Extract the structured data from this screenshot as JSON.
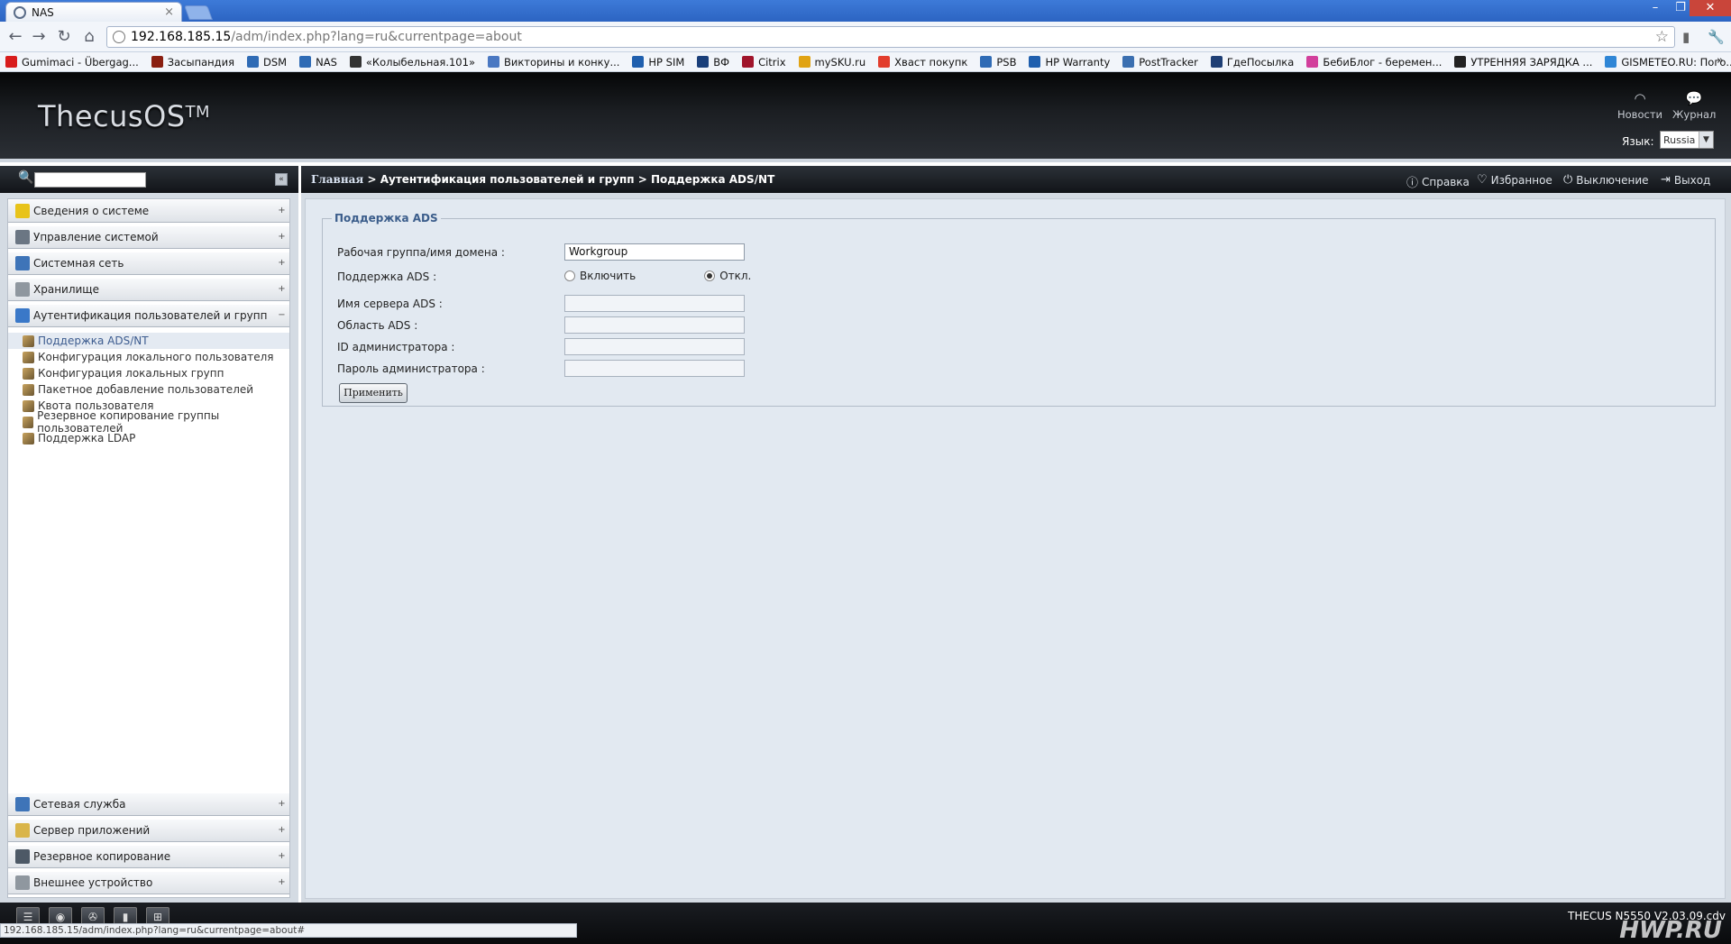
{
  "browser": {
    "tab_title": "NAS",
    "url_host": "192.168.185.15",
    "url_path": "/adm/index.php?lang=ru&currentpage=about",
    "bookmarks": [
      {
        "label": "Gumimaci - Übergag...",
        "color": "#d81c1c"
      },
      {
        "label": "Засыпандия",
        "color": "#8a1f11"
      },
      {
        "label": "DSM",
        "color": "#2f6bb5"
      },
      {
        "label": "NAS",
        "color": "#2f6bb5"
      },
      {
        "label": "«Колыбельная.101»",
        "color": "#333333"
      },
      {
        "label": "Викторины и конку...",
        "color": "#4a78c2"
      },
      {
        "label": "HP SIM",
        "color": "#1f5fae"
      },
      {
        "label": "ВФ",
        "color": "#1a3f7a"
      },
      {
        "label": "Citrix",
        "color": "#a0142b"
      },
      {
        "label": "mySKU.ru",
        "color": "#e0a314"
      },
      {
        "label": "Хвaст покупк",
        "color": "#e23d2d"
      },
      {
        "label": "PSB",
        "color": "#2f6bb5"
      },
      {
        "label": "HP Warranty",
        "color": "#1f5fae"
      },
      {
        "label": "PostTracker",
        "color": "#3b6fb0"
      },
      {
        "label": "ГдеПосылка",
        "color": "#1f3f75"
      },
      {
        "label": "БебиБлог - беремен...",
        "color": "#d23f9c"
      },
      {
        "label": "УТРЕННЯЯ ЗАРЯДКА ...",
        "color": "#222222"
      },
      {
        "label": "GISMETEO.RU: Пого...",
        "color": "#2f86d6"
      }
    ],
    "bookmarks_more": "»"
  },
  "header": {
    "logo_text": "ThecusOS",
    "logo_tm": "TM",
    "news": "Новости",
    "journal": "Журнал",
    "lang_label": "Язык:",
    "lang_value": "Russia"
  },
  "sidebar": {
    "groups_top": [
      {
        "label": "Сведения о системе",
        "icon_color": "#e8c31a",
        "toggle": "+"
      },
      {
        "label": "Управление системой",
        "icon_color": "#6b7683",
        "toggle": "+"
      },
      {
        "label": "Системная сеть",
        "icon_color": "#3e74b8",
        "toggle": "+"
      },
      {
        "label": "Хранилище",
        "icon_color": "#8f979f",
        "toggle": "+"
      },
      {
        "label": "Аутентификация пользователей и групп",
        "icon_color": "#3a78c8",
        "toggle": "−"
      }
    ],
    "sub_items": [
      {
        "label": "Поддержка ADS/NT",
        "active": true
      },
      {
        "label": "Конфигурация локального пользователя",
        "active": false
      },
      {
        "label": "Конфигурация локальных групп",
        "active": false
      },
      {
        "label": "Пакетное добавление пользователей",
        "active": false
      },
      {
        "label": "Квота пользователя",
        "active": false
      },
      {
        "label": "Резервное копирование группы пользователей",
        "active": false
      },
      {
        "label": "Поддержка LDAP",
        "active": false
      }
    ],
    "groups_bottom": [
      {
        "label": "Сетевая служба",
        "icon_color": "#3e74b8",
        "toggle": "+"
      },
      {
        "label": "Сервер приложений",
        "icon_color": "#d9b54a",
        "toggle": "+"
      },
      {
        "label": "Резервное копирование",
        "icon_color": "#4d5966",
        "toggle": "+"
      },
      {
        "label": "Внешнее устройство",
        "icon_color": "#8f979f",
        "toggle": "+"
      }
    ]
  },
  "main": {
    "breadcrumb_home": "Главная",
    "breadcrumb_rest": " > Аутентификация пользователей и групп > Поддержка ADS/NT",
    "actions": {
      "help": "Справка",
      "favorites": "Избранное",
      "shutdown": "Выключение",
      "logout": "Выход"
    },
    "form": {
      "legend": "Поддержка ADS",
      "workgroup_label": "Рабочая группа/имя домена :",
      "workgroup_value": "Workgroup",
      "ads_support_label": "Поддержка ADS :",
      "enable_label": "Включить",
      "disable_label": "Откл.",
      "ads_enabled": false,
      "server_label": "Имя сервера ADS :",
      "realm_label": "Область ADS :",
      "admin_id_label": "ID администратора :",
      "admin_pass_label": "Пароль администратора :",
      "apply_label": "Применить"
    }
  },
  "footer": {
    "model": "THECUS N5550 V2.03.09.cdv",
    "status_url": "192.168.185.15/adm/index.php?lang=ru&currentpage=about#",
    "watermark": "HWP.RU"
  }
}
